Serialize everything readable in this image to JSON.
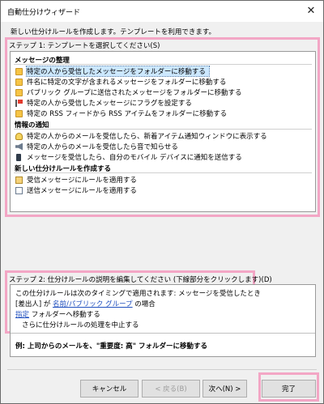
{
  "window": {
    "title": "自動仕分けウィザード",
    "close_glyph": "✕"
  },
  "subtitle": "新しい仕分けルールを作成します。テンプレートを利用できます。",
  "step1": {
    "label": "ステップ 1: テンプレートを選択してください(S)",
    "categories": [
      {
        "title": "メッセージの整理",
        "items": [
          {
            "label": "特定の人から受信したメッセージをフォルダーに移動する",
            "icon": "folder-move-icon",
            "selected": true
          },
          {
            "label": "件名に特定の文字が含まれるメッセージをフォルダーに移動する",
            "icon": "folder-move-icon"
          },
          {
            "label": "パブリック グループに送信されたメッセージをフォルダーに移動する",
            "icon": "folder-move-icon"
          },
          {
            "label": "特定の人から受信したメッセージにフラグを設定する",
            "icon": "flag-icon"
          },
          {
            "label": "特定の RSS フィードから RSS アイテムをフォルダーに移動する",
            "icon": "folder-move-icon"
          }
        ]
      },
      {
        "title": "情報の通知",
        "items": [
          {
            "label": "特定の人からのメールを受信したら、新着アイテム通知ウィンドウに表示する",
            "icon": "bell-icon"
          },
          {
            "label": "特定の人からのメールを受信したら音で知らせる",
            "icon": "speaker-icon"
          },
          {
            "label": "メッセージを受信したら、自分のモバイル デバイスに通知を送信する",
            "icon": "mobile-device-icon"
          }
        ]
      },
      {
        "title": "新しい仕分けルールを作成する",
        "items": [
          {
            "label": "受信メッセージにルールを適用する",
            "icon": "mail-receive-icon"
          },
          {
            "label": "送信メッセージにルールを適用する",
            "icon": "mail-send-icon"
          }
        ]
      }
    ]
  },
  "step2": {
    "label": "ステップ 2: 仕分けルールの説明を編集してください (下線部分をクリックします)(D)",
    "line1": "この仕分けルールは次のタイミングで適用されます: メッセージを受信したとき",
    "line2_prefix": "[差出人] が ",
    "line2_link": "名前/パブリック グループ",
    "line2_suffix": " の場合",
    "line3_link": "指定",
    "line3_suffix": " フォルダーへ移動する",
    "line4": "さらに仕分けルールの処理を中止する",
    "example": "例: 上司からのメールを、\"重要度: 高\" フォルダーに移動する"
  },
  "buttons": {
    "cancel": "キャンセル",
    "back": "< 戻る(B)",
    "next": "次へ(N) >",
    "finish": "完了"
  },
  "highlight_color": "#f3a6c5"
}
